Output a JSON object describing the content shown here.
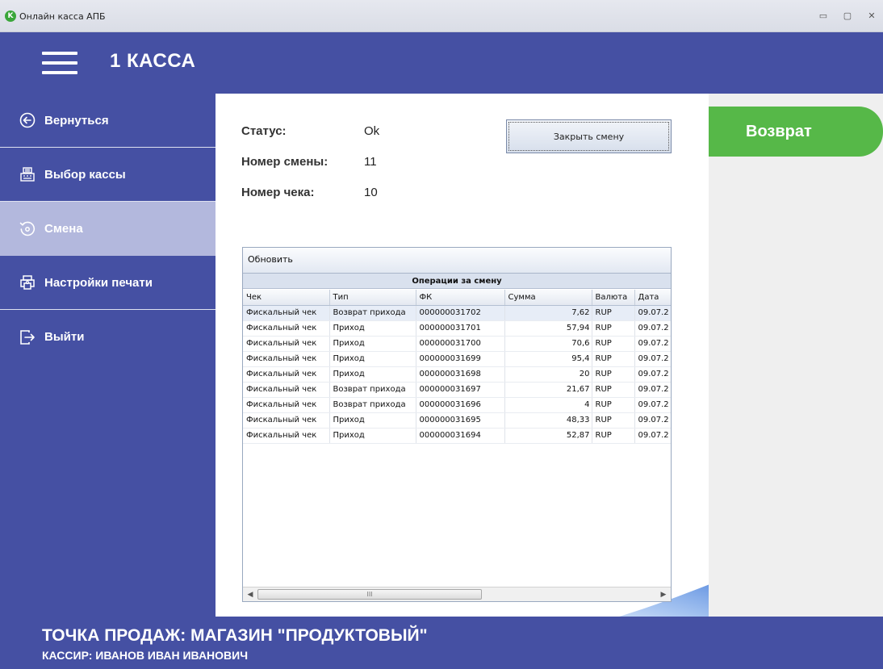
{
  "window": {
    "title": "Онлайн касса АПБ",
    "app_icon_letter": "K",
    "minimize": "▭",
    "maximize": "▢",
    "close": "✕"
  },
  "header": {
    "title": "1 КАССА"
  },
  "sidebar": {
    "items": [
      {
        "label": "Вернуться",
        "icon": "arrow-left-circle-icon"
      },
      {
        "label": "Выбор кассы",
        "icon": "cash-register-icon"
      },
      {
        "label": "Смена",
        "icon": "shift-clock-icon",
        "active": true
      },
      {
        "label": "Настройки печати",
        "icon": "printer-icon"
      },
      {
        "label": "Выйти",
        "icon": "exit-icon"
      }
    ]
  },
  "status": {
    "status_label": "Статус:",
    "status_value": "Ok",
    "shift_label": "Номер смены:",
    "shift_value": "11",
    "check_label": "Номер чека:",
    "check_value": "10"
  },
  "close_shift_label": "Закрыть смену",
  "grid": {
    "refresh_label": "Обновить",
    "caption": "Операции за смену",
    "columns": [
      "Чек",
      "Тип",
      "ФК",
      "Сумма",
      "Валюта",
      "Дата"
    ],
    "rows": [
      [
        "Фискальный чек",
        "Возврат прихода",
        "000000031702",
        "7,62",
        "RUP",
        "09.07.2"
      ],
      [
        "Фискальный чек",
        "Приход",
        "000000031701",
        "57,94",
        "RUP",
        "09.07.2"
      ],
      [
        "Фискальный чек",
        "Приход",
        "000000031700",
        "70,6",
        "RUP",
        "09.07.2"
      ],
      [
        "Фискальный чек",
        "Приход",
        "000000031699",
        "95,4",
        "RUP",
        "09.07.2"
      ],
      [
        "Фискальный чек",
        "Приход",
        "000000031698",
        "20",
        "RUP",
        "09.07.2"
      ],
      [
        "Фискальный чек",
        "Возврат прихода",
        "000000031697",
        "21,67",
        "RUP",
        "09.07.2"
      ],
      [
        "Фискальный чек",
        "Возврат прихода",
        "000000031696",
        "4",
        "RUP",
        "09.07.2"
      ],
      [
        "Фискальный чек",
        "Приход",
        "000000031695",
        "48,33",
        "RUP",
        "09.07.2"
      ],
      [
        "Фискальный чек",
        "Приход",
        "000000031694",
        "52,87",
        "RUP",
        "09.07.2"
      ]
    ],
    "scroll_left": "◀",
    "scroll_right": "▶",
    "scroll_grip": "III"
  },
  "return_button_label": "Возврат",
  "footer": {
    "point": "ТОЧКА ПРОДАЖ:  МАГАЗИН \"ПРОДУКТОВЫЙ\"",
    "cashier": "КАССИР: ИВАНОВ ИВАН ИВАНОВИЧ"
  },
  "colors": {
    "brand_blue": "#4550a3",
    "active_nav": "#b3b8dd",
    "return_green": "#56b848"
  }
}
